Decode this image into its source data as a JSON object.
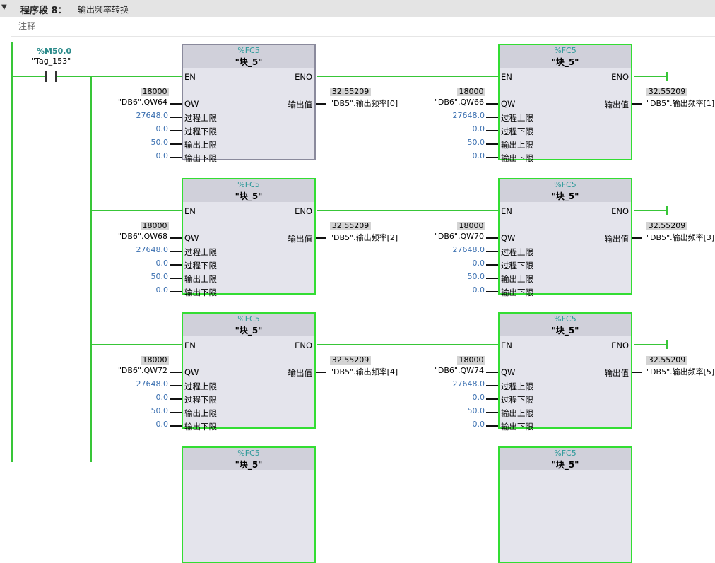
{
  "segment": {
    "collapse_icon": "triangle-down-icon",
    "title": "程序段 8：",
    "description": "输出频率转换",
    "comment": "注释"
  },
  "contact": {
    "address": "%M50.0",
    "tag": "\"Tag_153\""
  },
  "blocks": [
    {
      "fc": "%FC5",
      "name": "\"块_5\"",
      "en": "EN",
      "eno": "ENO",
      "qw_label": "QW",
      "in_labels": [
        "过程上限",
        "过程下限",
        "输出上限",
        "输出下限"
      ],
      "out_label": "输出值",
      "qw_value": "18000",
      "qw_tag": "\"DB6\".QW64",
      "in_values": [
        "27648.0",
        "0.0",
        "50.0",
        "0.0"
      ],
      "out_value": "32.55209",
      "out_tag": "\"DB5\".输出频率[0]"
    },
    {
      "fc": "%FC5",
      "name": "\"块_5\"",
      "en": "EN",
      "eno": "ENO",
      "qw_label": "QW",
      "in_labels": [
        "过程上限",
        "过程下限",
        "输出上限",
        "输出下限"
      ],
      "out_label": "输出值",
      "qw_value": "18000",
      "qw_tag": "\"DB6\".QW66",
      "in_values": [
        "27648.0",
        "0.0",
        "50.0",
        "0.0"
      ],
      "out_value": "32.55209",
      "out_tag": "\"DB5\".输出频率[1]"
    },
    {
      "fc": "%FC5",
      "name": "\"块_5\"",
      "en": "EN",
      "eno": "ENO",
      "qw_label": "QW",
      "in_labels": [
        "过程上限",
        "过程下限",
        "输出上限",
        "输出下限"
      ],
      "out_label": "输出值",
      "qw_value": "18000",
      "qw_tag": "\"DB6\".QW68",
      "in_values": [
        "27648.0",
        "0.0",
        "50.0",
        "0.0"
      ],
      "out_value": "32.55209",
      "out_tag": "\"DB5\".输出频率[2]"
    },
    {
      "fc": "%FC5",
      "name": "\"块_5\"",
      "en": "EN",
      "eno": "ENO",
      "qw_label": "QW",
      "in_labels": [
        "过程上限",
        "过程下限",
        "输出上限",
        "输出下限"
      ],
      "out_label": "输出值",
      "qw_value": "18000",
      "qw_tag": "\"DB6\".QW70",
      "in_values": [
        "27648.0",
        "0.0",
        "50.0",
        "0.0"
      ],
      "out_value": "32.55209",
      "out_tag": "\"DB5\".输出频率[3]"
    },
    {
      "fc": "%FC5",
      "name": "\"块_5\"",
      "en": "EN",
      "eno": "ENO",
      "qw_label": "QW",
      "in_labels": [
        "过程上限",
        "过程下限",
        "输出上限",
        "输出下限"
      ],
      "out_label": "输出值",
      "qw_value": "18000",
      "qw_tag": "\"DB6\".QW72",
      "in_values": [
        "27648.0",
        "0.0",
        "50.0",
        "0.0"
      ],
      "out_value": "32.55209",
      "out_tag": "\"DB5\".输出频率[4]"
    },
    {
      "fc": "%FC5",
      "name": "\"块_5\"",
      "en": "EN",
      "eno": "ENO",
      "qw_label": "QW",
      "in_labels": [
        "过程上限",
        "过程下限",
        "输出上限",
        "输出下限"
      ],
      "out_label": "输出值",
      "qw_value": "18000",
      "qw_tag": "\"DB6\".QW74",
      "in_values": [
        "27648.0",
        "0.0",
        "50.0",
        "0.0"
      ],
      "out_value": "32.55209",
      "out_tag": "\"DB5\".输出频率[5]"
    },
    {
      "fc": "%FC5",
      "name": "\"块_5\""
    },
    {
      "fc": "%FC5",
      "name": "\"块_5\""
    }
  ],
  "colors": {
    "wire": "#38c638",
    "block_border": "#33dd33",
    "address": "#2a8a8a",
    "constant": "#3a6fb0"
  }
}
